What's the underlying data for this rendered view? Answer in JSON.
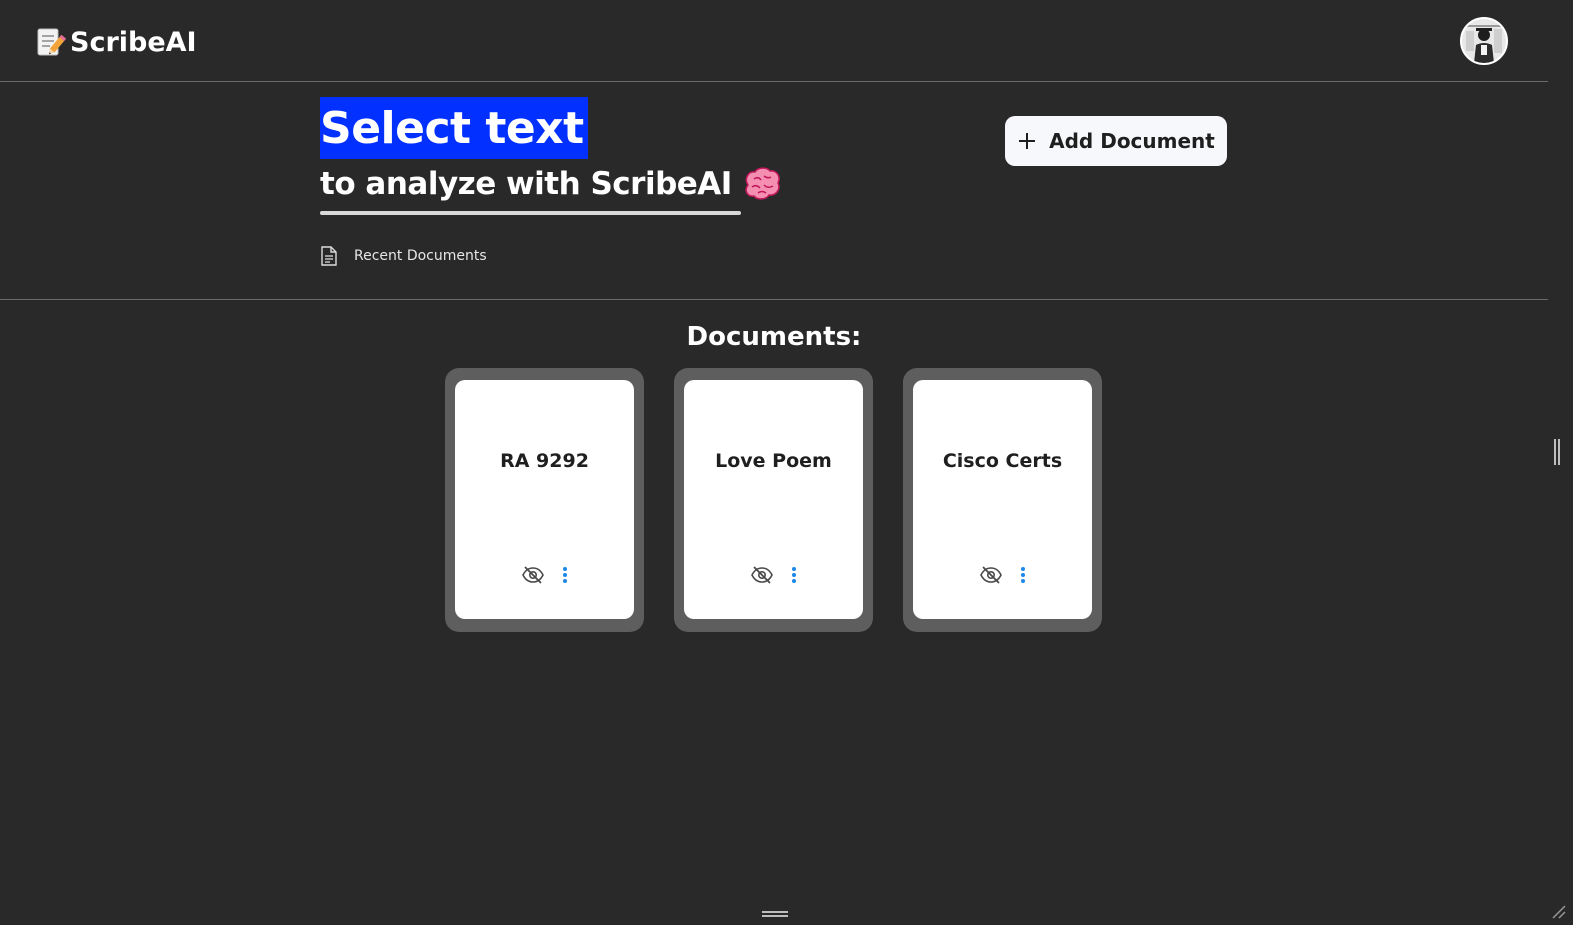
{
  "header": {
    "app_name": "ScribeAI",
    "brand_icon": "memo-pencil-icon",
    "avatar": "user-avatar"
  },
  "hero": {
    "highlight_text": "Select text",
    "subtitle": "to analyze with ScribeAI",
    "emoji_icon": "brain-icon",
    "highlight_color": "#0230ff"
  },
  "toolbar": {
    "add_document_label": "Add Document",
    "add_icon": "plus-icon"
  },
  "recent": {
    "label": "Recent Documents",
    "icon": "document-icon"
  },
  "documents": {
    "heading": "Documents:",
    "items": [
      {
        "title": "RA 9292"
      },
      {
        "title": "Love Poem"
      },
      {
        "title": "Cisco Certs"
      }
    ],
    "hide_icon": "eye-off-icon",
    "menu_icon": "more-vertical-icon",
    "menu_color": "#1e88e5"
  },
  "theme": {
    "background": "#292929",
    "card_frame": "#5e5e5e",
    "card": "#ffffff",
    "divider": "#6a6a6a"
  }
}
